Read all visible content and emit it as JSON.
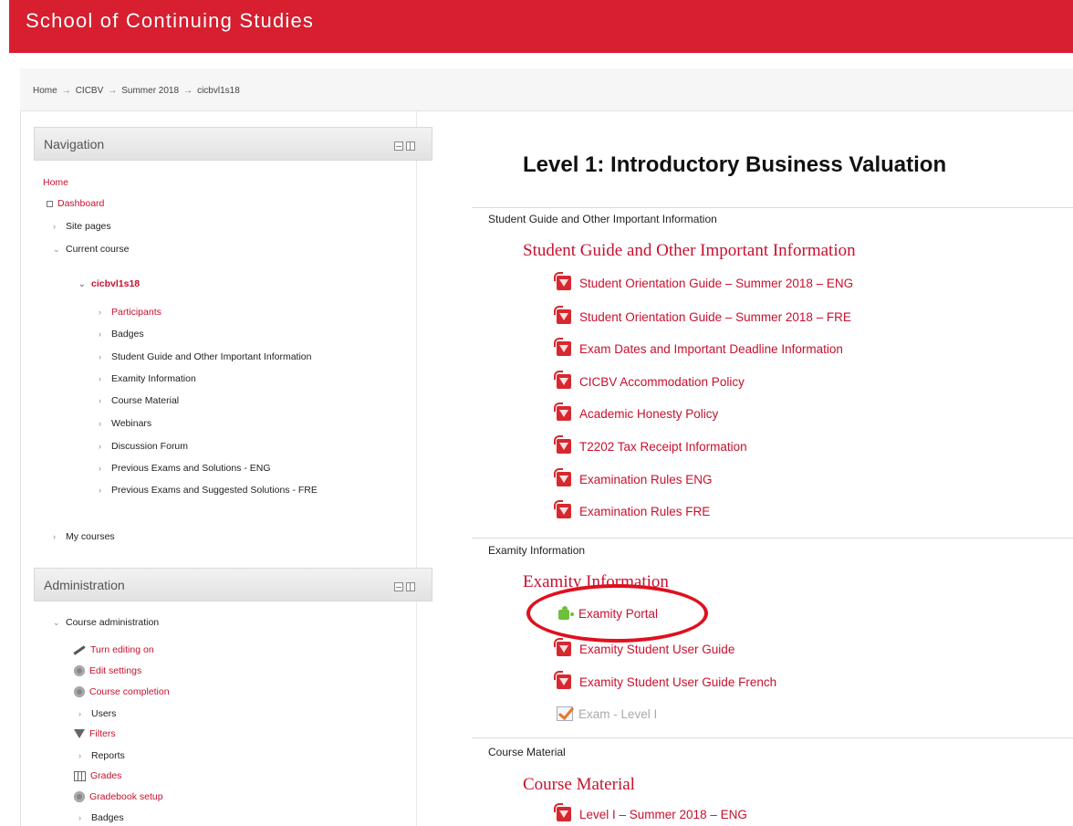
{
  "header": {
    "brand": "School of Continuing Studies",
    "color": "#d71f30"
  },
  "breadcrumb": [
    "Home",
    "CICBV",
    "Summer 2018",
    "cicbvl1s18"
  ],
  "breadcrumb_separator": "→",
  "navigation": {
    "title": "Navigation",
    "home": "Home",
    "dashboard": "Dashboard",
    "site_pages": "Site pages",
    "current_course": "Current course",
    "course_code": "cicbvl1s18",
    "course_items": [
      "Participants",
      "Badges",
      "Student Guide and Other Important Information",
      "Examity Information",
      "Course Material",
      "Webinars",
      "Discussion Forum",
      "Previous Exams and Solutions - ENG",
      "Previous Exams and Suggested Solutions - FRE"
    ],
    "my_courses": "My courses"
  },
  "administration": {
    "title": "Administration",
    "course_admin": "Course administration",
    "items": [
      "Turn editing on",
      "Edit settings",
      "Course completion",
      "Users",
      "Filters",
      "Reports",
      "Grades",
      "Gradebook setup",
      "Badges"
    ]
  },
  "main": {
    "title": "Level 1: Introductory Business Valuation",
    "sections": [
      {
        "label": "Student Guide and Other Important Information",
        "heading": "Student Guide and Other Important Information",
        "resources": [
          "Student Orientation Guide – Summer 2018 – ENG",
          "Student Orientation Guide – Summer 2018 – FRE",
          "Exam Dates and Important Deadline Information",
          "CICBV Accommodation Policy",
          "Academic Honesty Policy",
          "T2202 Tax Receipt Information",
          "Examination Rules ENG",
          "Examination Rules FRE"
        ]
      },
      {
        "label": "Examity Information",
        "heading": "Examity Information",
        "resources": [
          "Examity Portal",
          "Examity Student User Guide",
          "Examity Student User Guide French",
          "Exam - Level I"
        ]
      },
      {
        "label": "Course Material",
        "heading": "Course Material",
        "resources": [
          "Level I – Summer 2018 – ENG"
        ]
      }
    ]
  },
  "accent_color": "#c8102e",
  "annotation_color": "#e0101e"
}
